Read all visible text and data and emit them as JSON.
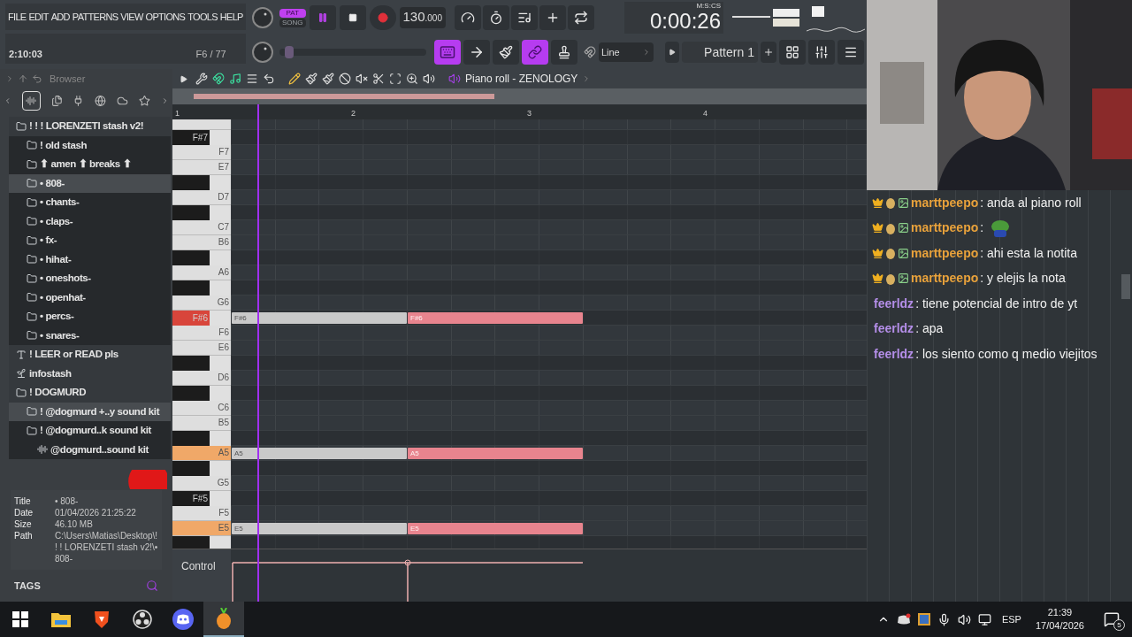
{
  "menu": [
    "FILE",
    "EDIT",
    "ADD",
    "PATTERNS",
    "VIEW",
    "OPTIONS",
    "TOOLS",
    "HELP"
  ],
  "hint_bar": {
    "time": "2:10:03",
    "position": "F6 / 77"
  },
  "transport": {
    "modes": [
      {
        "label": "PAT",
        "selected": true
      },
      {
        "label": "SONG",
        "selected": false
      }
    ],
    "playing": true,
    "tempo": "130",
    "tempo_fraction": ".000",
    "time": "0:00:26",
    "time_format": "M:S:CS"
  },
  "pitch": {
    "level": 0.04
  },
  "toolbar": {
    "buttons": [
      {
        "kind": "piano",
        "on": true
      },
      {
        "kind": "arrow",
        "on": false
      },
      {
        "kind": "brush",
        "on": false
      },
      {
        "kind": "link",
        "on": true
      },
      {
        "kind": "stamp",
        "on": false
      }
    ],
    "snap": "Line",
    "pattern": "Pattern 1"
  },
  "browser": {
    "title": "Browser",
    "tree": [
      {
        "label": "! ! ! LORENZETI stash v2!",
        "kind": "folder",
        "selected": false,
        "children": [
          {
            "label": "! old stash",
            "kind": "folder",
            "selected": false
          },
          {
            "label": "⬆ amen ⬆ breaks ⬆",
            "kind": "folder",
            "selected": false
          },
          {
            "label": "• 808-",
            "kind": "folder",
            "selected": true
          },
          {
            "label": "• chants-",
            "kind": "folder",
            "selected": false
          },
          {
            "label": "• claps-",
            "kind": "folder",
            "selected": false
          },
          {
            "label": "• fx-",
            "kind": "folder",
            "selected": false
          },
          {
            "label": "• hihat-",
            "kind": "folder",
            "selected": false
          },
          {
            "label": "• oneshots-",
            "kind": "folder",
            "selected": false
          },
          {
            "label": "• openhat-",
            "kind": "folder",
            "selected": false
          },
          {
            "label": "• percs-",
            "kind": "folder",
            "selected": false
          },
          {
            "label": "• snares-",
            "kind": "folder",
            "selected": false
          }
        ]
      },
      {
        "label": "! LEER or READ pls",
        "kind": "text",
        "selected": false
      },
      {
        "label": "infostash",
        "kind": "sprout",
        "selected": false
      },
      {
        "label": "! DOGMURD",
        "kind": "folder",
        "selected": false,
        "children": [
          {
            "label": "! @dogmurd +..y sound kit",
            "kind": "folder",
            "selected": true
          },
          {
            "label": "! @dogmurd..k sound kit",
            "kind": "folder",
            "selected": false,
            "children": [
              {
                "label": "@dogmurd..sound kit",
                "kind": "pack",
                "selected": false
              }
            ]
          }
        ]
      }
    ],
    "info": [
      {
        "label": "Title",
        "value": "• 808-"
      },
      {
        "label": "Date",
        "value": "01/04/2026 21:25:22"
      },
      {
        "label": "Size",
        "value": "46.10 MB"
      },
      {
        "label": "Path",
        "value": "C:\\Users\\Matias\\Desktop\\! ! ! LORENZETI stash v2!\\• 808-"
      }
    ],
    "tags": "TAGS"
  },
  "piano_roll": {
    "title": "Piano roll - ZENOLOGY",
    "bars": [
      "1",
      "2",
      "3",
      "4"
    ],
    "control": "Control",
    "keys": [
      {
        "kind": "white"
      },
      {
        "kind": "black",
        "label": "F#7"
      },
      {
        "kind": "white",
        "label": "F7"
      },
      {
        "kind": "white",
        "label": "E7"
      },
      {
        "kind": "black"
      },
      {
        "kind": "white",
        "label": "D7"
      },
      {
        "kind": "black"
      },
      {
        "kind": "white",
        "label": "C7"
      },
      {
        "kind": "white",
        "label": "B6"
      },
      {
        "kind": "black"
      },
      {
        "kind": "white",
        "label": "A6"
      },
      {
        "kind": "black"
      },
      {
        "kind": "white",
        "label": "G6"
      },
      {
        "kind": "black",
        "label": "F#6",
        "color": "#d8453b",
        "notes": [
          {
            "label": "F#6",
            "selected": false
          },
          {
            "label": "F#6",
            "selected": true
          }
        ]
      },
      {
        "kind": "white",
        "label": "F6"
      },
      {
        "kind": "white",
        "label": "E6"
      },
      {
        "kind": "black"
      },
      {
        "kind": "white",
        "label": "D6"
      },
      {
        "kind": "black"
      },
      {
        "kind": "white",
        "label": "C6"
      },
      {
        "kind": "white",
        "label": "B5"
      },
      {
        "kind": "black"
      },
      {
        "kind": "white",
        "label": "A5",
        "color": "#f0a868",
        "notes": [
          {
            "label": "A5",
            "selected": false
          },
          {
            "label": "A5",
            "selected": true
          }
        ]
      },
      {
        "kind": "black"
      },
      {
        "kind": "white",
        "label": "G5"
      },
      {
        "kind": "black",
        "label": "F#5"
      },
      {
        "kind": "white",
        "label": "F5"
      },
      {
        "kind": "white",
        "label": "E5",
        "color": "#f0a868",
        "notes": [
          {
            "label": "E5",
            "selected": false
          },
          {
            "label": "E5",
            "selected": true
          }
        ]
      },
      {
        "kind": "black"
      }
    ]
  },
  "chat": [
    {
      "user": "marttpeepo",
      "color": "#e9a23b",
      "badges": true,
      "kind": "text",
      "text": ": anda al piano roll"
    },
    {
      "user": "marttpeepo",
      "color": "#e9a23b",
      "badges": true,
      "kind": "emote",
      "text": ":"
    },
    {
      "user": "marttpeepo",
      "color": "#e9a23b",
      "badges": true,
      "kind": "text",
      "text": ": ahi esta la notita"
    },
    {
      "user": "marttpeepo",
      "color": "#e9a23b",
      "badges": true,
      "kind": "text",
      "text": ": y elejis la nota"
    },
    {
      "user": "feerldz",
      "color": "#b48ee8",
      "badges": false,
      "kind": "text",
      "text": ": tiene potencial de intro de yt"
    },
    {
      "user": "feerldz",
      "color": "#b48ee8",
      "badges": false,
      "kind": "text",
      "text": ": apa"
    },
    {
      "user": "feerldz",
      "color": "#b48ee8",
      "badges": false,
      "kind": "text",
      "text": ": los siento como q medio viejitos"
    }
  ],
  "taskbar": {
    "apps": [
      {
        "kind": "windows",
        "selected": false
      },
      {
        "kind": "folder",
        "selected": false
      },
      {
        "kind": "brave",
        "selected": false
      },
      {
        "kind": "obs",
        "selected": false
      },
      {
        "kind": "discord",
        "selected": false
      },
      {
        "kind": "fl",
        "selected": true
      }
    ],
    "language": "ESP",
    "time": "21:39",
    "date": "17/04/2026",
    "notifications": "5"
  }
}
